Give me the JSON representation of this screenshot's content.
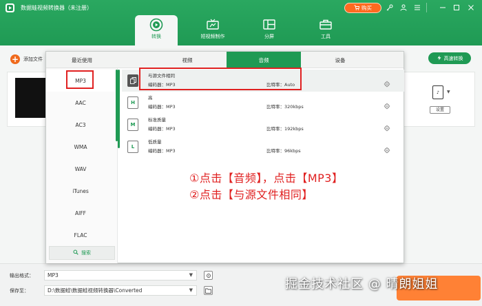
{
  "app": {
    "title": "数据蛙视频转换器（未注册）",
    "buy_label": "购买"
  },
  "main_tabs": [
    {
      "label": "转换",
      "active": true
    },
    {
      "label": "短视频制作",
      "active": false
    },
    {
      "label": "分屏",
      "active": false
    },
    {
      "label": "工具",
      "active": false
    }
  ],
  "toolbar": {
    "add_file_label": "添加文件",
    "fast_convert_label": "高速转换"
  },
  "file_card": {
    "settings_label": "设置"
  },
  "format_popup": {
    "tabs": [
      {
        "label": "最近使用",
        "active": false
      },
      {
        "label": "视频",
        "active": false
      },
      {
        "label": "音频",
        "active": true
      },
      {
        "label": "设备",
        "active": false
      }
    ],
    "formats": [
      "MP3",
      "AAC",
      "AC3",
      "WMA",
      "WAV",
      "iTunes",
      "AIFF",
      "FLAC"
    ],
    "selected_format": "MP3",
    "search_label": "搜索",
    "presets": [
      {
        "name": "与源文件相同",
        "codec": "编码器：MP3",
        "bitrate": "比特率：Auto",
        "icon": "same-as-source-icon"
      },
      {
        "name": "高",
        "codec": "编码器：MP3",
        "bitrate": "比特率：320kbps",
        "icon": "high-quality-icon"
      },
      {
        "name": "标准质量",
        "codec": "编码器：MP3",
        "bitrate": "比特率：192kbps",
        "icon": "medium-quality-icon"
      },
      {
        "name": "低质量",
        "codec": "编码器：MP3",
        "bitrate": "比特率：96kbps",
        "icon": "low-quality-icon"
      }
    ]
  },
  "annotation": {
    "line1": "①点击【音频】，点击【MP3】",
    "line2": "②点击【与源文件相同】"
  },
  "bottom": {
    "output_format_label": "输出格式：",
    "output_format_value": "MP3",
    "save_to_label": "保存至：",
    "save_to_value": "D:\\数据蛙\\数据蛙视频转换器\\Converted"
  },
  "watermark": "掘金技术社区 @ 晴朗姐姐",
  "colors": {
    "brand_green": "#1f9a54",
    "accent_orange": "#ff6a1f",
    "annotation_red": "#e02020"
  }
}
